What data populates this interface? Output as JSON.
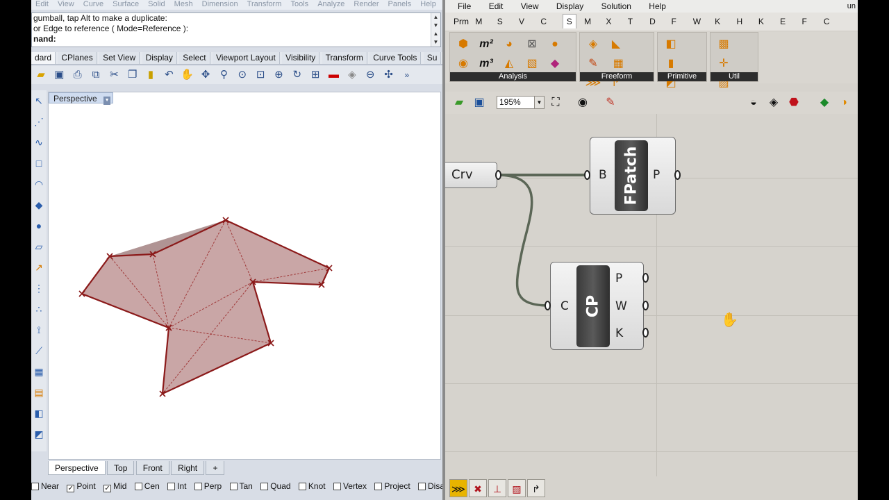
{
  "rhino": {
    "menu": [
      "Edit",
      "View",
      "Curve",
      "Surface",
      "Solid",
      "Mesh",
      "Dimension",
      "Transform",
      "Tools",
      "Analyze",
      "Render",
      "Panels",
      "Help"
    ],
    "command_history": [
      "gumball, tap Alt to make a duplicate:",
      " or Edge to reference ( Mode=Reference ):",
      "nand:"
    ],
    "toolbar_tabs": [
      "dard",
      "CPlanes",
      "Set View",
      "Display",
      "Select",
      "Viewport Layout",
      "Visibility",
      "Transform",
      "Curve Tools",
      "Su"
    ],
    "toolbar_icons": [
      "open-icon",
      "save-icon",
      "print-icon",
      "import-icon",
      "cut-icon",
      "copy-icon",
      "paste-icon",
      "undo-icon",
      "pan-icon",
      "move-icon",
      "zoom-icon",
      "zoom-window-icon",
      "zoom-extents-icon",
      "zoom-selected-icon",
      "rotate-view-icon",
      "grid-icon",
      "car-icon",
      "shade-icon",
      "target-icon",
      "snap-icon",
      "more-icon"
    ],
    "viewport": {
      "label": "Perspective",
      "tabs": [
        "Perspective",
        "Top",
        "Front",
        "Right"
      ],
      "add_tab_icon": "plus-icon"
    },
    "osnap": [
      {
        "label": "Near",
        "checked": false
      },
      {
        "label": "Point",
        "checked": true
      },
      {
        "label": "Mid",
        "checked": true
      },
      {
        "label": "Cen",
        "checked": false
      },
      {
        "label": "Int",
        "checked": false
      },
      {
        "label": "Perp",
        "checked": false
      },
      {
        "label": "Tan",
        "checked": false
      },
      {
        "label": "Quad",
        "checked": false
      },
      {
        "label": "Knot",
        "checked": false
      },
      {
        "label": "Vertex",
        "checked": false
      },
      {
        "label": "Project",
        "checked": false
      },
      {
        "label": "Disable",
        "checked": false
      }
    ]
  },
  "grasshopper": {
    "menu": [
      "File",
      "Edit",
      "View",
      "Display",
      "Solution",
      "Help"
    ],
    "menu_right": "un",
    "categories": [
      "Prm",
      "M",
      "S",
      "V",
      "C",
      "S",
      "M",
      "X",
      "T",
      "D",
      "F",
      "W",
      "K",
      "H",
      "K",
      "E",
      "F",
      "C"
    ],
    "active_category": "S",
    "ribbon_groups": [
      {
        "label": "Analysis"
      },
      {
        "label": "Freeform"
      },
      {
        "label": "Primitive"
      },
      {
        "label": "Util"
      }
    ],
    "ribbon_glyphs": {
      "m2": "m²",
      "m3": "m³"
    },
    "zoom": "195%",
    "components": {
      "crv_param": {
        "label": "Crv"
      },
      "fpatch": {
        "name": "FPatch",
        "input": "B",
        "output": "P"
      },
      "cp": {
        "name": "CP",
        "input": "C",
        "outputs": [
          "P",
          "W",
          "K"
        ]
      }
    },
    "colors": {
      "curve_red": "#8b1a1a",
      "surface_fill": "#c9a6a6",
      "wire": "#5b6656",
      "ribbon_label_bg": "#2d2d2d"
    }
  }
}
